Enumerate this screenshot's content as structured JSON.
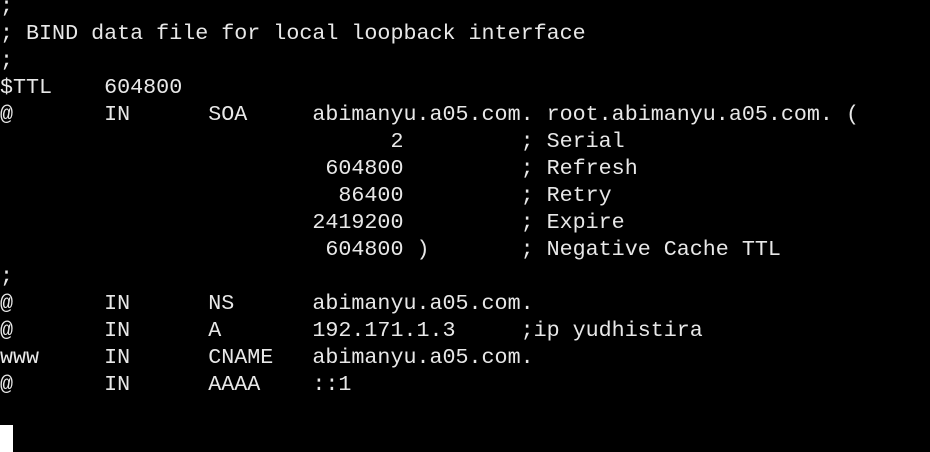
{
  "terminal": {
    "lines": [
      ";",
      "; BIND data file for local loopback interface",
      ";",
      "$TTL    604800",
      "@       IN      SOA     abimanyu.a05.com. root.abimanyu.a05.com. (",
      "                              2         ; Serial",
      "                         604800         ; Refresh",
      "                          86400         ; Retry",
      "                        2419200         ; Expire",
      "                         604800 )       ; Negative Cache TTL",
      ";",
      "@       IN      NS      abimanyu.a05.com.",
      "@       IN      A       192.171.1.3     ;ip yudhistira",
      "www     IN      CNAME   abimanyu.a05.com.",
      "@       IN      AAAA    ::1",
      ""
    ]
  },
  "colors": {
    "background": "#000000",
    "text": "#e8e8e8",
    "cursor": "#ffffff"
  }
}
